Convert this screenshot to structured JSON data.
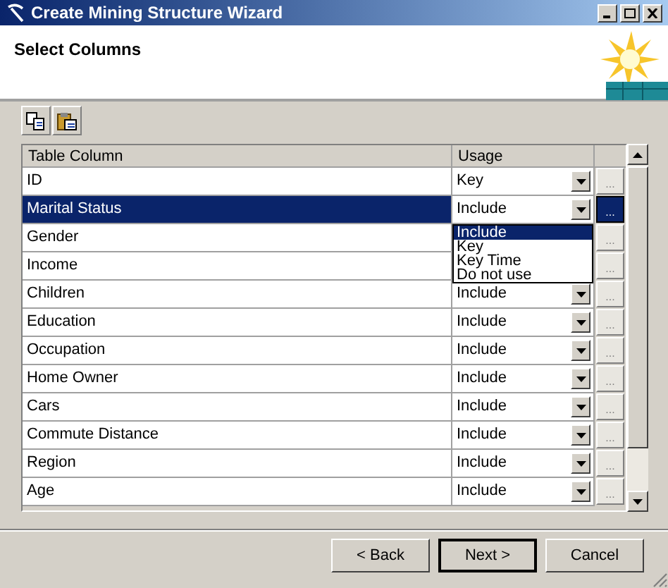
{
  "window": {
    "title": "Create Mining Structure Wizard"
  },
  "header": {
    "title": "Select Columns"
  },
  "table": {
    "columns": [
      "Table Column",
      "Usage"
    ],
    "rows": [
      {
        "name": "ID",
        "usage": "Key",
        "button": "...",
        "selected": false
      },
      {
        "name": "Marital Status",
        "usage": "Include",
        "button": "...",
        "selected": true,
        "dropdown_options": [
          {
            "label": "Include",
            "selected": true
          },
          {
            "label": "Key",
            "selected": false
          },
          {
            "label": "Key Time",
            "selected": false
          },
          {
            "label": "Do not use",
            "selected": false
          }
        ]
      },
      {
        "name": "Gender",
        "button": "...",
        "selected": false
      },
      {
        "name": "Income",
        "button": "...",
        "selected": false
      },
      {
        "name": "Children",
        "usage": "Include",
        "button": "...",
        "selected": false
      },
      {
        "name": "Education",
        "usage": "Include",
        "button": "...",
        "selected": false
      },
      {
        "name": "Occupation",
        "usage": "Include",
        "button": "...",
        "selected": false
      },
      {
        "name": "Home Owner",
        "usage": "Include",
        "button": "...",
        "selected": false
      },
      {
        "name": "Cars",
        "usage": "Include",
        "button": "...",
        "selected": false
      },
      {
        "name": "Commute Distance",
        "usage": "Include",
        "button": "...",
        "selected": false
      },
      {
        "name": "Region",
        "usage": "Include",
        "button": "...",
        "selected": false
      },
      {
        "name": "Age",
        "usage": "Include",
        "button": "...",
        "selected": false
      }
    ]
  },
  "buttons": [
    {
      "label": "< Back",
      "default": false
    },
    {
      "label": "Next >",
      "default": true
    },
    {
      "label": "Cancel",
      "default": false
    }
  ]
}
